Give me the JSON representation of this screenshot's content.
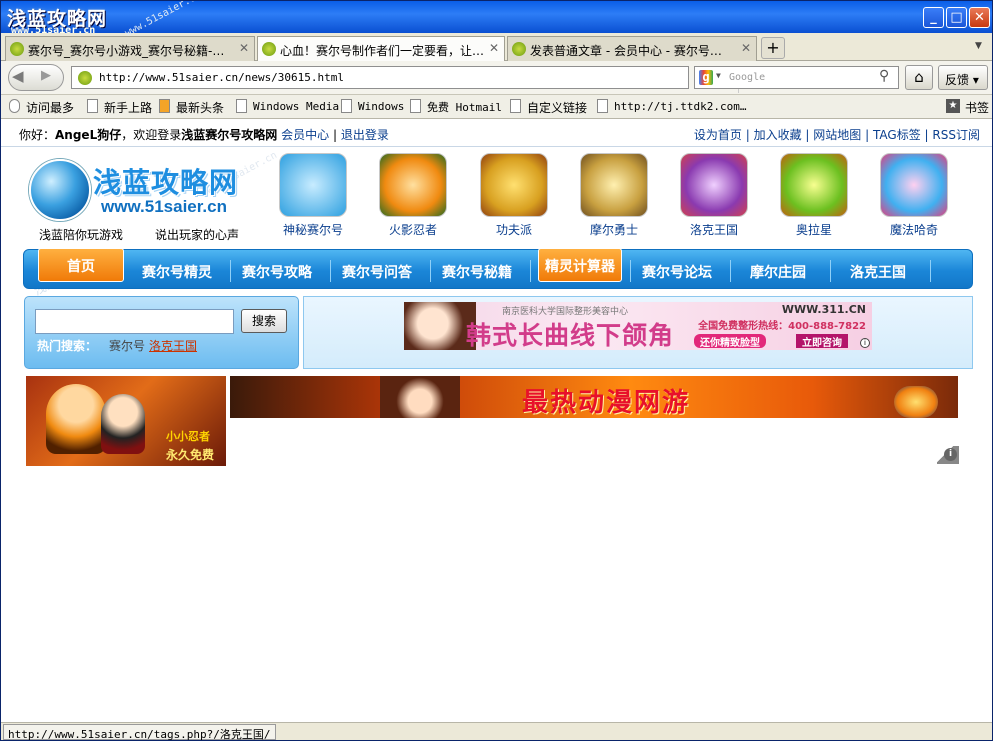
{
  "window": {
    "logo_text": "浅蓝攻略网",
    "logo_url": "www.51saier.cn",
    "minimize_glyph": "_",
    "maximize_glyph": "□",
    "close_glyph": "✕"
  },
  "tabs": [
    {
      "label": "赛尔号_赛尔号小游戏_赛尔号秘籍-…",
      "active": false
    },
    {
      "label": "心血！赛尔号制作者们一定要看，让…",
      "active": true
    },
    {
      "label": "发表普通文章 - 会员中心 - 赛尔号…",
      "active": false
    }
  ],
  "tab_close_glyph": "✕",
  "new_tab_glyph": "+",
  "tab_list_glyph": "▼",
  "nav": {
    "back_glyph": "◀",
    "forward_glyph": "▶",
    "url": "http://www.51saier.cn/news/30615.html",
    "star_glyph": "☆",
    "reload_glyph": "↻",
    "search_engine_glyph": "g",
    "search_engine_drop": "▼",
    "search_placeholder": "Google",
    "search_glyph": "⚲",
    "home_glyph": "⌂",
    "feedback_label": "反馈 ▾"
  },
  "bookmarks": [
    {
      "label": "访问最多",
      "icon": "magnifier-icon"
    },
    {
      "label": "新手上路",
      "icon": "page-icon"
    },
    {
      "label": "最新头条",
      "icon": "rss-icon"
    },
    {
      "label": "Windows Media",
      "icon": "page-icon"
    },
    {
      "label": "Windows",
      "icon": "page-icon"
    },
    {
      "label": "免费 Hotmail",
      "icon": "page-icon"
    },
    {
      "label": "自定义链接",
      "icon": "page-icon"
    },
    {
      "label": "http://tj.ttdk2.com…",
      "icon": "page-icon"
    }
  ],
  "bookmarks_tag_glyph": "★",
  "bookmarks_tags_label": "书签",
  "site": {
    "greeting_prefix": "你好：",
    "username": "AngeL狗仔",
    "welcome_text": "，欢迎登录",
    "site_name": "浅蓝赛尔号攻略网",
    "member_center": "会员中心",
    "sep": "|",
    "logout": "退出登录",
    "top_links": [
      "设为首页",
      "加入收藏",
      "网站地图",
      "TAG标签",
      "RSS订阅"
    ],
    "logo_cn": "浅蓝攻略网",
    "logo_url": "www.51saier.cn",
    "slogan1": "浅蓝陪你玩游戏",
    "slogan2": "说出玩家的心声",
    "games": [
      {
        "label": "神秘赛尔号",
        "color": "#2ea0e0"
      },
      {
        "label": "火影忍者",
        "color": "#f08a10"
      },
      {
        "label": "功夫派",
        "color": "#d8a020"
      },
      {
        "label": "摩尔勇士",
        "color": "#c8a040"
      },
      {
        "label": "洛克王国",
        "color": "#8a3ab0"
      },
      {
        "label": "奥拉星",
        "color": "#6cc020"
      },
      {
        "label": "魔法哈奇",
        "color": "#40b0f0"
      }
    ],
    "menu": [
      "首页",
      "赛尔号精灵",
      "赛尔号攻略",
      "赛尔号问答",
      "赛尔号秘籍",
      "精灵计算器",
      "赛尔号论坛",
      "摩尔庄园",
      "洛克王国"
    ],
    "search_button": "搜索",
    "hot_label": "热门搜索：",
    "hot_items": [
      "赛尔号",
      "洛克王国"
    ],
    "ad1": {
      "org": "南京医科大学国际整形美容中心",
      "title": "韩式长曲线下颌角",
      "url": "WWW.311.CN",
      "tel": "全国免费整形热线：400-888-7822",
      "btn": "还你精致脸型",
      "btn2": "立即咨询",
      "info": "i"
    },
    "banner_left_logo": "小小忍者",
    "banner_left_free": "永久免费",
    "banner_main_text": "最热动漫网游",
    "ad_info": "i"
  },
  "watermark": {
    "url": "www.51saier.cn",
    "cn": "浅蓝攻略网"
  },
  "status": "http://www.51saier.cn/tags.php?/洛克王国/"
}
